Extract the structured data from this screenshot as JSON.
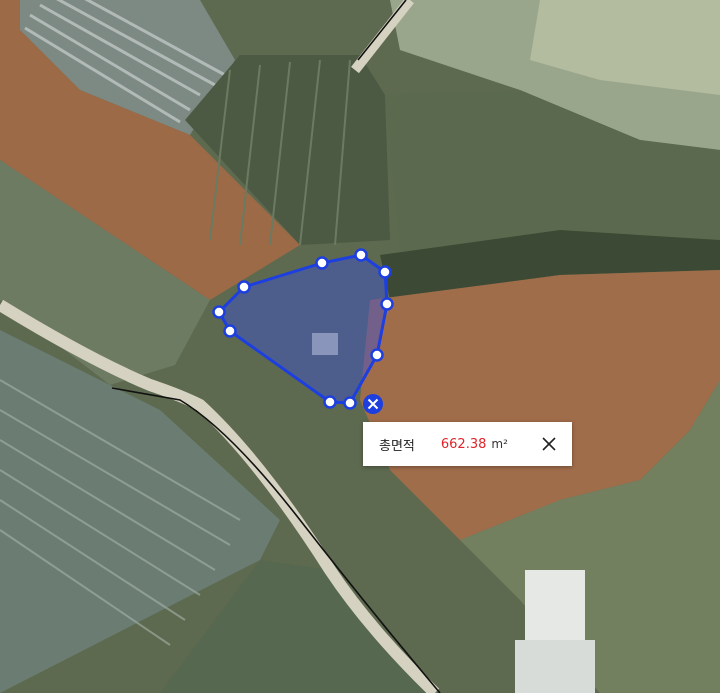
{
  "measurement": {
    "label": "총면적",
    "value": "662.38",
    "unit": "m²",
    "value_color": "#e0242a"
  },
  "polygon": {
    "stroke_color": "#1d3fe0",
    "fill_color": "#3b4fd6"
  },
  "icons": {
    "close": "close-icon",
    "delete_polygon": "delete-x-icon"
  }
}
